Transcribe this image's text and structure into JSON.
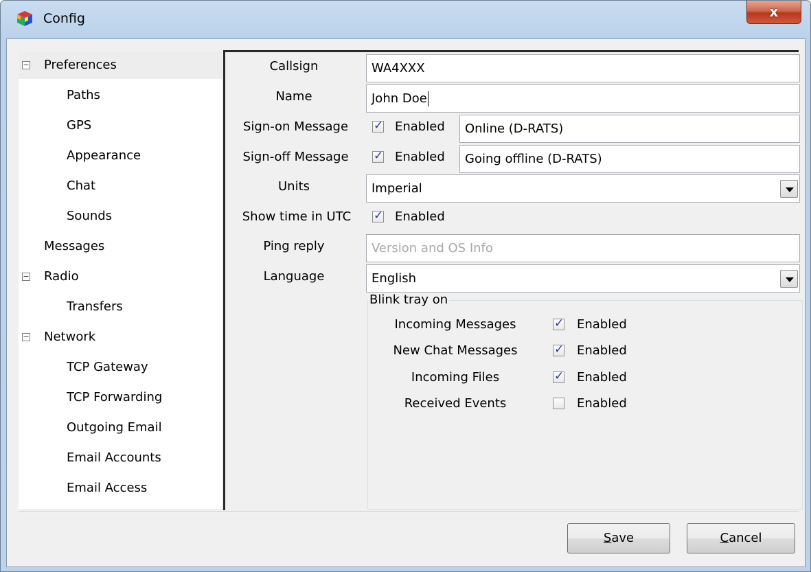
{
  "window": {
    "title": "Config",
    "close_label": "x"
  },
  "tree": {
    "items": [
      {
        "label": "Preferences",
        "expander": "⊟"
      },
      {
        "label": "Paths"
      },
      {
        "label": "GPS"
      },
      {
        "label": "Appearance"
      },
      {
        "label": "Chat"
      },
      {
        "label": "Sounds"
      },
      {
        "label": "Messages"
      },
      {
        "label": "Radio",
        "expander": "⊟"
      },
      {
        "label": "Transfers"
      },
      {
        "label": "Network",
        "expander": "⊟"
      },
      {
        "label": "TCP Gateway"
      },
      {
        "label": "TCP Forwarding"
      },
      {
        "label": "Outgoing Email"
      },
      {
        "label": "Email Accounts"
      },
      {
        "label": "Email Access"
      }
    ]
  },
  "form": {
    "callsign": {
      "label": "Callsign",
      "value": "WA4XXX"
    },
    "name": {
      "label": "Name",
      "value": "John Doe"
    },
    "signon": {
      "label": "Sign-on Message",
      "enabled_label": "Enabled",
      "checked": true,
      "value": "Online (D-RATS)"
    },
    "signoff": {
      "label": "Sign-off Message",
      "enabled_label": "Enabled",
      "checked": true,
      "value": "Going offline (D-RATS)"
    },
    "units": {
      "label": "Units",
      "value": "Imperial"
    },
    "utc": {
      "label": "Show time in UTC",
      "enabled_label": "Enabled",
      "checked": true
    },
    "ping": {
      "label": "Ping reply",
      "placeholder": "Version and OS Info"
    },
    "language": {
      "label": "Language",
      "value": "English"
    },
    "blink": {
      "title": "Blink tray on",
      "rows": [
        {
          "label": "Incoming Messages",
          "enabled_label": "Enabled",
          "checked": true
        },
        {
          "label": "New Chat Messages",
          "enabled_label": "Enabled",
          "checked": true
        },
        {
          "label": "Incoming Files",
          "enabled_label": "Enabled",
          "checked": true
        },
        {
          "label": "Received Events",
          "enabled_label": "Enabled",
          "checked": false
        }
      ]
    }
  },
  "buttons": {
    "save": {
      "mnemonic": "S",
      "rest": "ave"
    },
    "cancel": {
      "mnemonic": "C",
      "rest": "ancel"
    }
  }
}
